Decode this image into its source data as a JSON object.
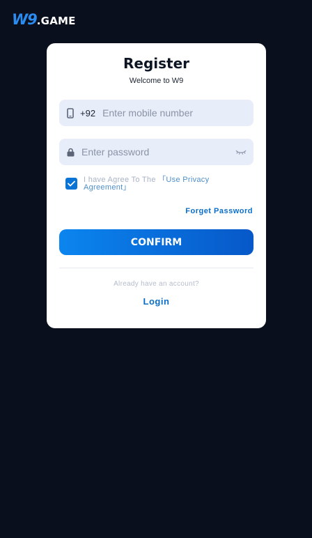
{
  "header": {
    "logo_mark": "W9",
    "logo_text": ".GAME"
  },
  "form": {
    "title": "Register",
    "subtitle": "Welcome to W9",
    "phone": {
      "country_code": "+92",
      "placeholder": "Enter mobile number",
      "value": ""
    },
    "password": {
      "placeholder": "Enter password",
      "value": ""
    },
    "agree": {
      "checked": true,
      "text": "I have Agree To The",
      "link": "「Use Privacy Agreement」"
    },
    "forget_password": "Forget Password",
    "confirm_label": "CONFIRM",
    "already_text": "Already have an account?",
    "login_label": "Login"
  },
  "colors": {
    "background": "#090f1c",
    "accent": "#0a6ec8",
    "field_bg": "#e8eef9"
  }
}
